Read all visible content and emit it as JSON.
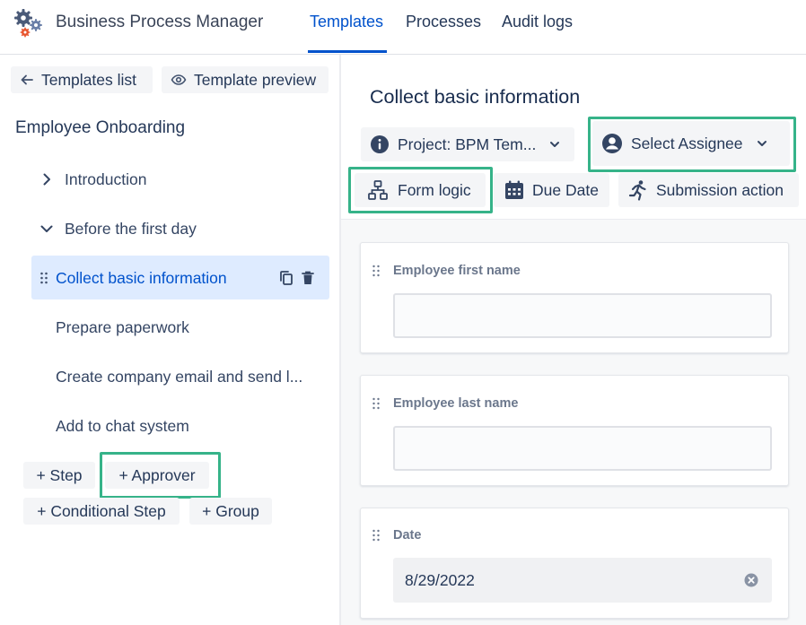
{
  "header": {
    "logo_icon": "gears-logo-icon",
    "app_title": "Business Process Manager",
    "tabs": [
      {
        "label": "Templates",
        "active": true
      },
      {
        "label": "Processes",
        "active": false
      },
      {
        "label": "Audit logs",
        "active": false
      }
    ]
  },
  "sidebar": {
    "templates_list_label": "Templates list",
    "template_preview_label": "Template preview",
    "template_name": "Employee Onboarding",
    "tree": [
      {
        "label": "Introduction",
        "icon": "chevron-right-icon"
      },
      {
        "label": "Before the first day",
        "icon": "chevron-down-icon"
      },
      {
        "label": "Collect basic information",
        "selected": true
      },
      {
        "label": "Prepare paperwork"
      },
      {
        "label": "Create company email and send l..."
      },
      {
        "label": "Add to chat system"
      }
    ],
    "add_buttons": {
      "step": "+ Step",
      "approver": "+ Approver",
      "conditional_step": "+ Conditional Step",
      "group": "+ Group"
    }
  },
  "panel": {
    "title": "Collect basic information",
    "project_label": "Project: BPM Tem...",
    "assignee_label": "Select Assignee",
    "form_logic_label": "Form logic",
    "due_date_label": "Due Date",
    "submission_action_label": "Submission action",
    "fields": [
      {
        "label": "Employee first name",
        "value": ""
      },
      {
        "label": "Employee last name",
        "value": ""
      },
      {
        "label": "Date",
        "value": "8/29/2022"
      }
    ]
  },
  "colors": {
    "accent": "#0052cc",
    "highlight": "#36b389",
    "selected_bg": "#deebff"
  }
}
